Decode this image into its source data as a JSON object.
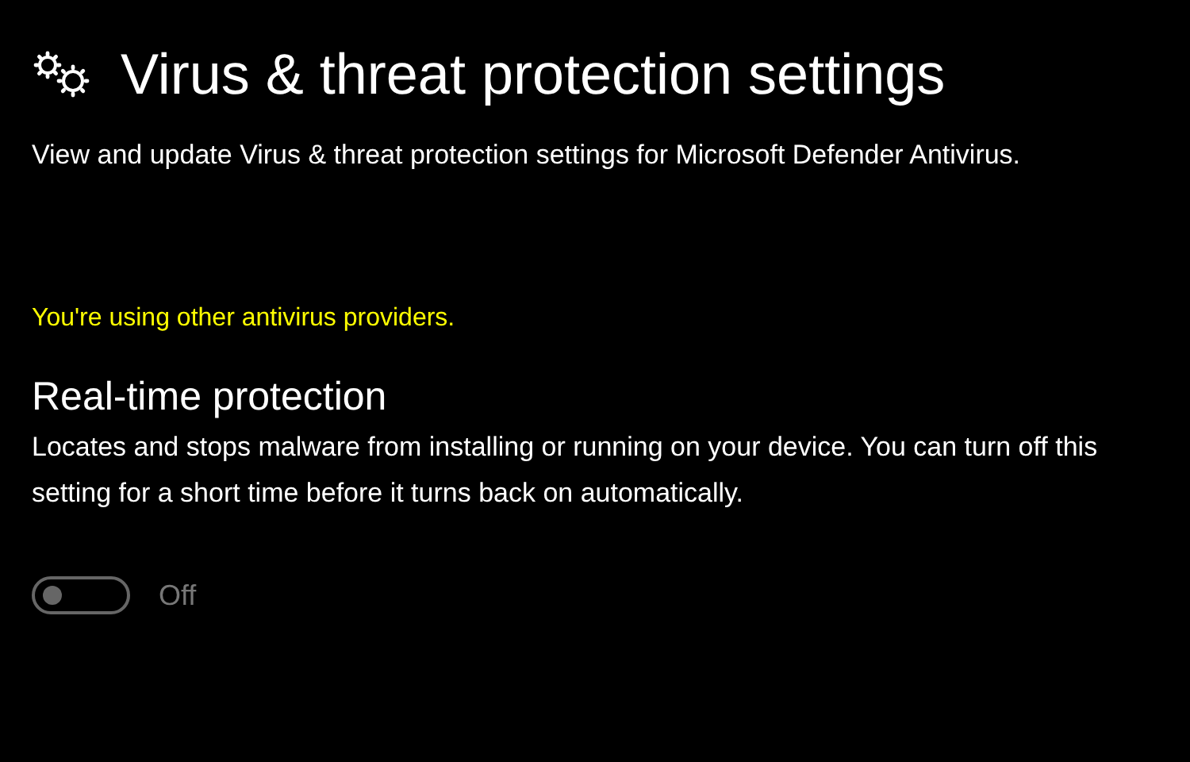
{
  "header": {
    "title": "Virus & threat protection settings",
    "description": "View and update Virus & threat protection settings for Microsoft Defender Antivirus."
  },
  "warning": "You're using other antivirus providers.",
  "section": {
    "title": "Real-time protection",
    "description": "Locates and stops malware from installing or running on your device. You can turn off this setting for a short time before it turns back on automatically.",
    "toggle": {
      "on": false,
      "disabled": true,
      "label": "Off"
    }
  }
}
